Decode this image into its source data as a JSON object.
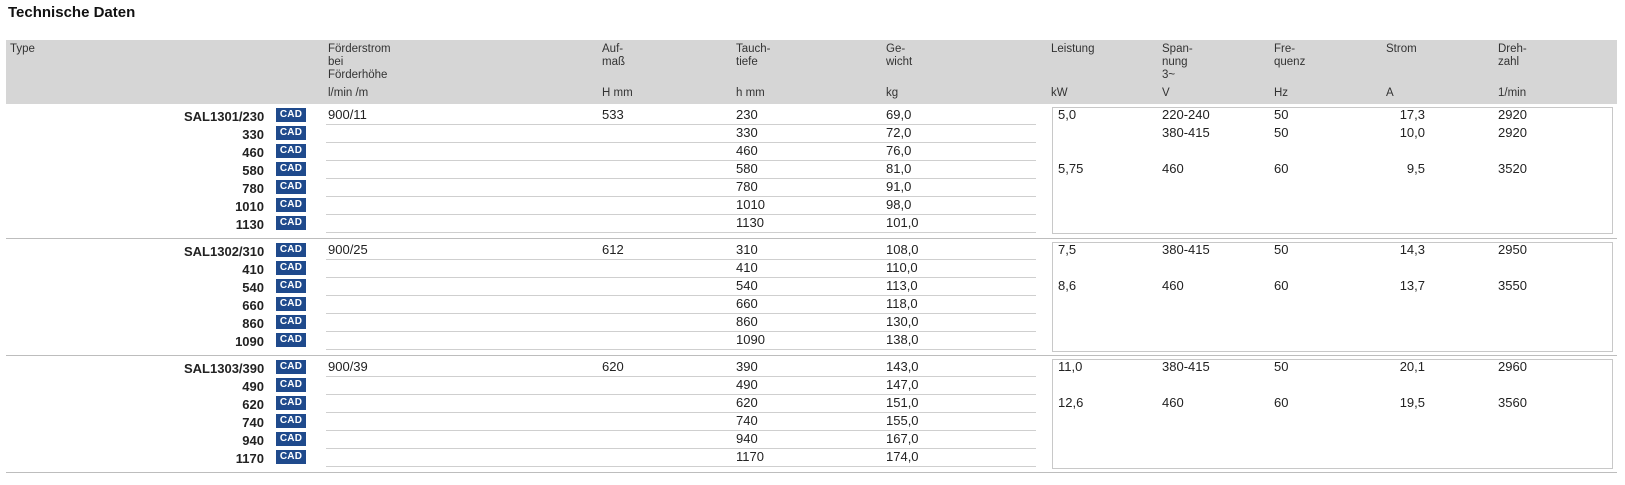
{
  "title": "Technische Daten",
  "headers": {
    "type": "Type",
    "foerder": "Förderstrom\nbei\nFörderhöhe",
    "foerder_unit": "l/min /m",
    "aufmass": "Auf-\nmaß",
    "aufmass_unit": "H mm",
    "tauch": "Tauch-\ntiefe",
    "tauch_unit": "h mm",
    "gewicht": "Ge-\nwicht",
    "gewicht_unit": "kg",
    "leistung": "Leistung",
    "leistung_unit": "kW",
    "spannung": "Span-\nnung\n3~",
    "spannung_unit": "V",
    "frequenz": "Fre-\nquenz",
    "frequenz_unit": "Hz",
    "strom": "Strom",
    "strom_unit": "A",
    "drehzahl": "Dreh-\nzahl",
    "drehzahl_unit": "1/min"
  },
  "cad_label": "CAD",
  "groups": [
    {
      "foerder": "900/11",
      "aufmass": "533",
      "rows": [
        {
          "name": "SAL1301/230",
          "tauch": "230",
          "gewicht": "69,0"
        },
        {
          "name": "330",
          "tauch": "330",
          "gewicht": "72,0"
        },
        {
          "name": "460",
          "tauch": "460",
          "gewicht": "76,0"
        },
        {
          "name": "580",
          "tauch": "580",
          "gewicht": "81,0"
        },
        {
          "name": "780",
          "tauch": "780",
          "gewicht": "91,0"
        },
        {
          "name": "1010",
          "tauch": "1010",
          "gewicht": "98,0"
        },
        {
          "name": "1130",
          "tauch": "1130",
          "gewicht": "101,0"
        }
      ],
      "electric": [
        {
          "leistung": "5,0",
          "spannung": "220-240",
          "frequenz": "50",
          "strom": "17,3",
          "drehzahl": "2920"
        },
        {
          "leistung": "",
          "spannung": "380-415",
          "frequenz": "50",
          "strom": "10,0",
          "drehzahl": "2920"
        },
        {
          "leistung": "5,75",
          "spannung": "460",
          "frequenz": "60",
          "strom": "9,5",
          "drehzahl": "3520"
        }
      ]
    },
    {
      "foerder": "900/25",
      "aufmass": "612",
      "rows": [
        {
          "name": "SAL1302/310",
          "tauch": "310",
          "gewicht": "108,0"
        },
        {
          "name": "410",
          "tauch": "410",
          "gewicht": "110,0"
        },
        {
          "name": "540",
          "tauch": "540",
          "gewicht": "113,0"
        },
        {
          "name": "660",
          "tauch": "660",
          "gewicht": "118,0"
        },
        {
          "name": "860",
          "tauch": "860",
          "gewicht": "130,0"
        },
        {
          "name": "1090",
          "tauch": "1090",
          "gewicht": "138,0"
        }
      ],
      "electric": [
        {
          "leistung": "7,5",
          "spannung": "380-415",
          "frequenz": "50",
          "strom": "14,3",
          "drehzahl": "2950"
        },
        {
          "leistung": "8,6",
          "spannung": "460",
          "frequenz": "60",
          "strom": "13,7",
          "drehzahl": "3550"
        }
      ]
    },
    {
      "foerder": "900/39",
      "aufmass": "620",
      "rows": [
        {
          "name": "SAL1303/390",
          "tauch": "390",
          "gewicht": "143,0"
        },
        {
          "name": "490",
          "tauch": "490",
          "gewicht": "147,0"
        },
        {
          "name": "620",
          "tauch": "620",
          "gewicht": "151,0"
        },
        {
          "name": "740",
          "tauch": "740",
          "gewicht": "155,0"
        },
        {
          "name": "940",
          "tauch": "940",
          "gewicht": "167,0"
        },
        {
          "name": "1170",
          "tauch": "1170",
          "gewicht": "174,0"
        }
      ],
      "electric": [
        {
          "leistung": "11,0",
          "spannung": "380-415",
          "frequenz": "50",
          "strom": "20,1",
          "drehzahl": "2960"
        },
        {
          "leistung": "12,6",
          "spannung": "460",
          "frequenz": "60",
          "strom": "19,5",
          "drehzahl": "3560"
        }
      ]
    }
  ]
}
